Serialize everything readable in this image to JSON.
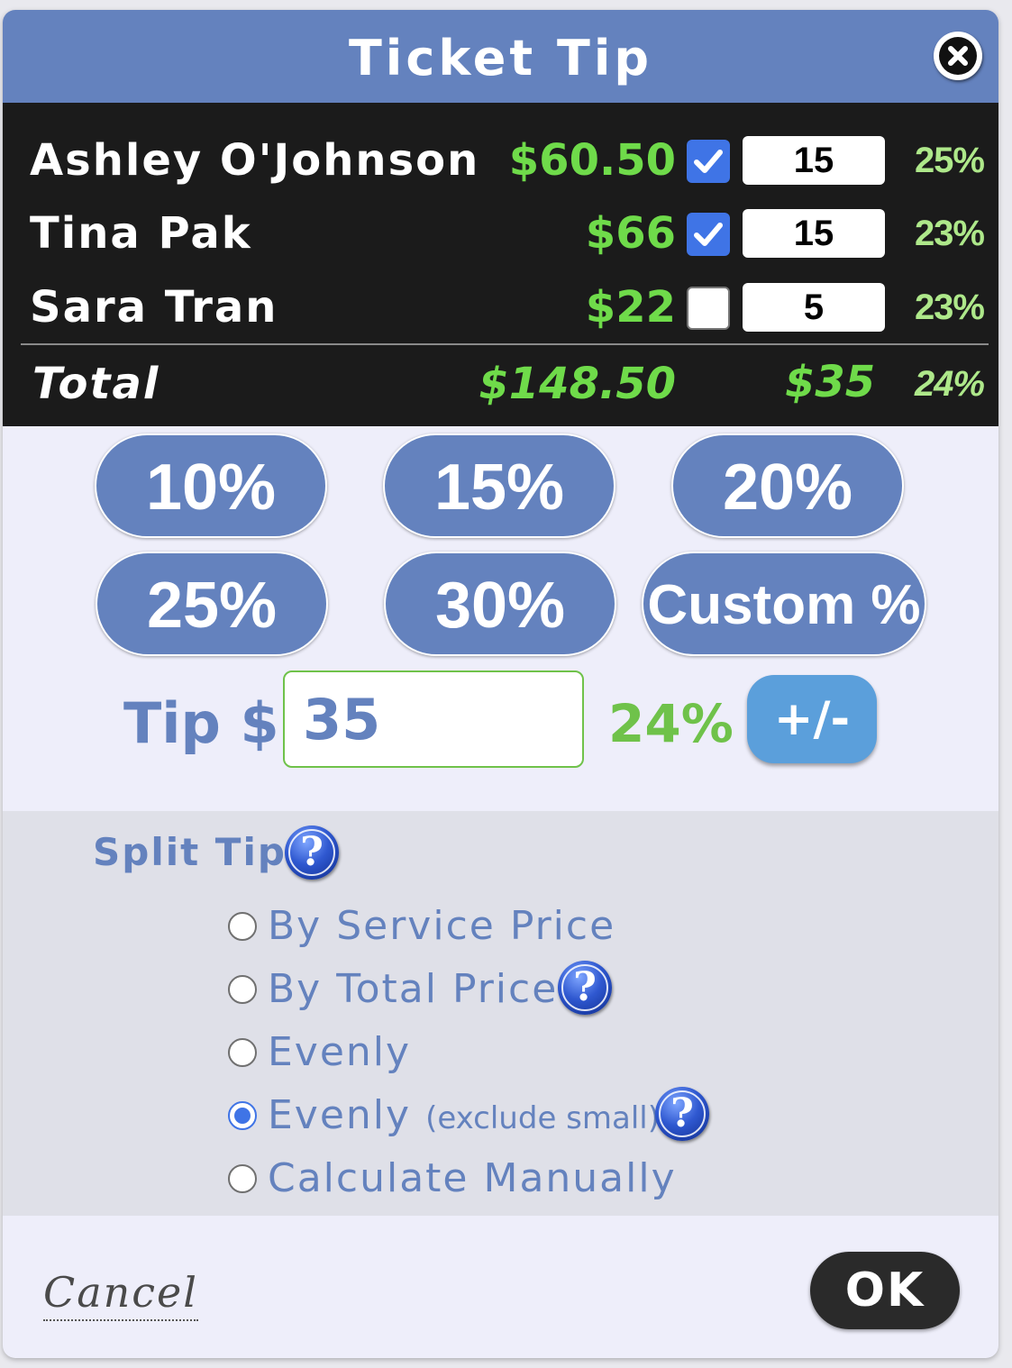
{
  "dialog": {
    "title": "Ticket Tip",
    "close_icon": "close-icon"
  },
  "staff": [
    {
      "name": "Ashley O'Johnson",
      "price": "$60.50",
      "checked": true,
      "tip": "15",
      "percent": "25%"
    },
    {
      "name": "Tina Pak",
      "price": "$66",
      "checked": true,
      "tip": "15",
      "percent": "23%"
    },
    {
      "name": "Sara Tran",
      "price": "$22",
      "checked": false,
      "tip": "5",
      "percent": "23%"
    }
  ],
  "total": {
    "label": "Total",
    "price": "$148.50",
    "tip": "$35",
    "percent": "24%"
  },
  "percent_buttons": [
    "10%",
    "15%",
    "20%",
    "25%",
    "30%",
    "Custom %"
  ],
  "tip": {
    "label": "Tip $",
    "value": "35",
    "percent": "24%",
    "adjust_label": "+/-"
  },
  "split": {
    "title": "Split Tip",
    "options": [
      {
        "label": "By Service Price",
        "note": "",
        "selected": false,
        "help": false
      },
      {
        "label": "By Total Price",
        "note": "",
        "selected": false,
        "help": true
      },
      {
        "label": "Evenly",
        "note": "",
        "selected": false,
        "help": false
      },
      {
        "label": "Evenly",
        "note": "(exclude small)",
        "selected": true,
        "help": true
      },
      {
        "label": "Calculate Manually",
        "note": "",
        "selected": false,
        "help": false
      }
    ]
  },
  "actions": {
    "cancel": "Cancel",
    "ok": "OK"
  },
  "colors": {
    "header": "#6482be",
    "staff_bg": "#1b1b1b",
    "price_green": "#6fdb4a",
    "percent_green": "#aee88a",
    "checkbox_blue": "#3f74e6",
    "button_blue": "#6482be",
    "adjust_blue": "#5b9fdb",
    "ok_bg": "#2a2a2a"
  }
}
